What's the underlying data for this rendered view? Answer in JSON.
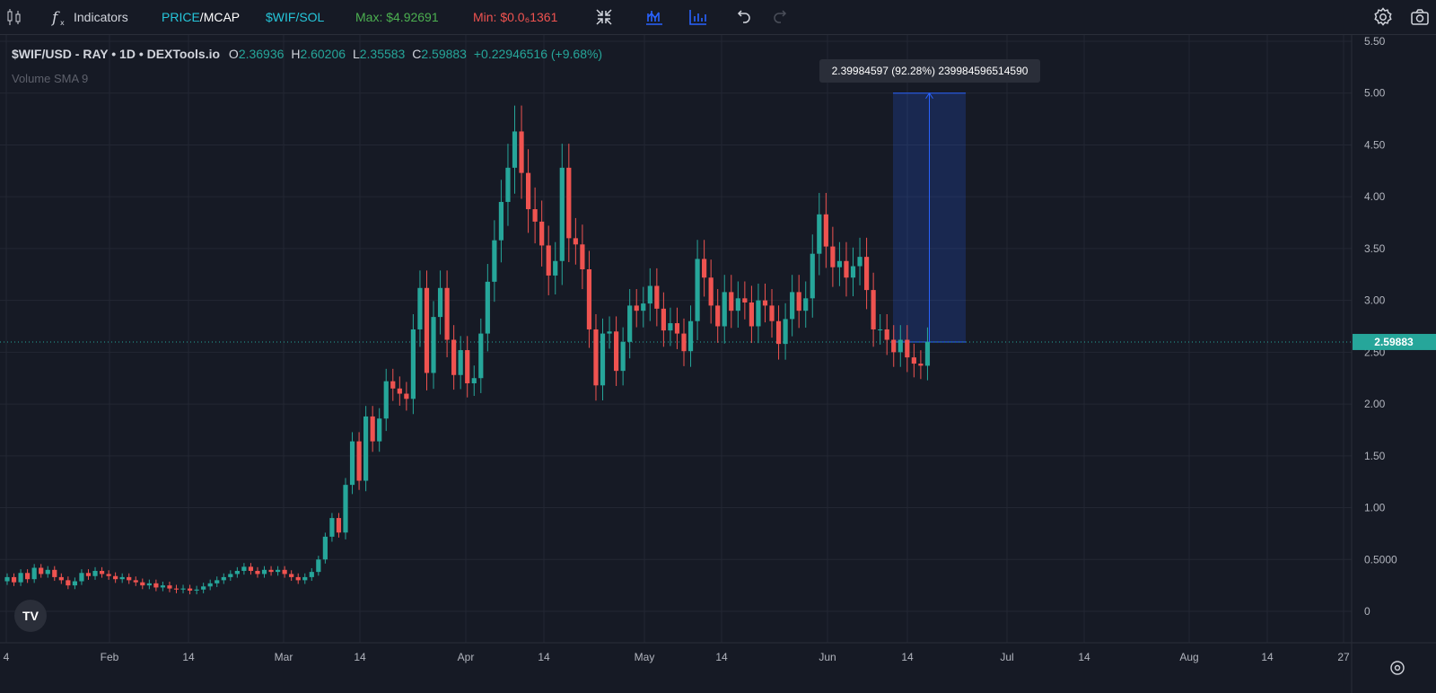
{
  "toolbar": {
    "indicators_label": "Indicators",
    "price_label": "PRICE",
    "slash": "/",
    "mcap_label": "MCAP",
    "pair_label": "$WIF/SOL",
    "max_label": "Max: $4.92691",
    "min_label": "Min: $0.0₆1361",
    "icons": [
      "candles-icon",
      "fx-icon",
      "collapse-icon",
      "chart-type-icon",
      "bars-icon",
      "undo-icon",
      "redo-icon",
      "settings-icon",
      "camera-icon"
    ]
  },
  "legend": {
    "symbol": "$WIF/USD - RAY • 1D • DEXTools.io",
    "o_label": "O",
    "o_value": "2.36936",
    "h_label": "H",
    "h_value": "2.60206",
    "l_label": "L",
    "l_value": "2.35583",
    "c_label": "C",
    "c_value": "2.59883",
    "change": "+0.22946516 (+9.68%)",
    "indicator": "Volume SMA 9"
  },
  "measure_label": "2.39984597 (92.28%) 239984596514590",
  "colors": {
    "up": "#26a69a",
    "down": "#ef5350",
    "bg": "#161a25",
    "grid": "#232733",
    "accent": "#2962ff"
  },
  "chart_data": {
    "type": "candlestick",
    "y_ticks": [
      "5.50",
      "5.00",
      "4.50",
      "4.00",
      "3.50",
      "3.00",
      "2.50",
      "2.00",
      "1.50",
      "1.00",
      "0.5000",
      "0"
    ],
    "ylim": [
      0,
      5.5
    ],
    "x_ticks": [
      "4",
      "Feb",
      "14",
      "Mar",
      "14",
      "Apr",
      "14",
      "May",
      "14",
      "Jun",
      "14",
      "Jul",
      "14",
      "Aug",
      "14",
      "27"
    ],
    "last_price": 2.59883,
    "last_price_label": "2.59883",
    "measure": {
      "from": 2.59883,
      "to": 5.0
    },
    "series": [
      {
        "o": 0.29,
        "c": 0.33
      },
      {
        "o": 0.33,
        "c": 0.28
      },
      {
        "o": 0.28,
        "c": 0.37
      },
      {
        "o": 0.37,
        "c": 0.31
      },
      {
        "o": 0.31,
        "c": 0.42
      },
      {
        "o": 0.42,
        "c": 0.36
      },
      {
        "o": 0.36,
        "c": 0.4
      },
      {
        "o": 0.4,
        "c": 0.33
      },
      {
        "o": 0.33,
        "c": 0.3
      },
      {
        "o": 0.3,
        "c": 0.25
      },
      {
        "o": 0.25,
        "c": 0.29
      },
      {
        "o": 0.29,
        "c": 0.37
      },
      {
        "o": 0.37,
        "c": 0.34
      },
      {
        "o": 0.34,
        "c": 0.39
      },
      {
        "o": 0.39,
        "c": 0.36
      },
      {
        "o": 0.36,
        "c": 0.34
      },
      {
        "o": 0.34,
        "c": 0.31
      },
      {
        "o": 0.31,
        "c": 0.33
      },
      {
        "o": 0.33,
        "c": 0.3
      },
      {
        "o": 0.3,
        "c": 0.28
      },
      {
        "o": 0.28,
        "c": 0.25
      },
      {
        "o": 0.25,
        "c": 0.27
      },
      {
        "o": 0.27,
        "c": 0.23
      },
      {
        "o": 0.23,
        "c": 0.25
      },
      {
        "o": 0.25,
        "c": 0.22
      },
      {
        "o": 0.22,
        "c": 0.21
      },
      {
        "o": 0.21,
        "c": 0.22
      },
      {
        "o": 0.22,
        "c": 0.2
      },
      {
        "o": 0.2,
        "c": 0.21
      },
      {
        "o": 0.21,
        "c": 0.24
      },
      {
        "o": 0.24,
        "c": 0.27
      },
      {
        "o": 0.27,
        "c": 0.3
      },
      {
        "o": 0.3,
        "c": 0.33
      },
      {
        "o": 0.33,
        "c": 0.36
      },
      {
        "o": 0.36,
        "c": 0.39
      },
      {
        "o": 0.39,
        "c": 0.43
      },
      {
        "o": 0.43,
        "c": 0.39
      },
      {
        "o": 0.39,
        "c": 0.36
      },
      {
        "o": 0.36,
        "c": 0.4
      },
      {
        "o": 0.4,
        "c": 0.38
      },
      {
        "o": 0.38,
        "c": 0.4
      },
      {
        "o": 0.4,
        "c": 0.36
      },
      {
        "o": 0.36,
        "c": 0.33
      },
      {
        "o": 0.33,
        "c": 0.3
      },
      {
        "o": 0.3,
        "c": 0.33
      },
      {
        "o": 0.33,
        "c": 0.38
      },
      {
        "o": 0.38,
        "c": 0.5
      },
      {
        "o": 0.5,
        "c": 0.72
      },
      {
        "o": 0.72,
        "c": 0.9
      },
      {
        "o": 0.9,
        "c": 0.76
      },
      {
        "o": 0.76,
        "c": 1.22
      },
      {
        "o": 1.22,
        "c": 1.64
      },
      {
        "o": 1.64,
        "c": 1.26
      },
      {
        "o": 1.26,
        "c": 1.88
      },
      {
        "o": 1.88,
        "c": 1.64
      },
      {
        "o": 1.64,
        "c": 1.86
      },
      {
        "o": 1.86,
        "c": 2.22
      },
      {
        "o": 2.22,
        "c": 2.15
      },
      {
        "o": 2.15,
        "c": 2.1
      },
      {
        "o": 2.1,
        "c": 2.05
      },
      {
        "o": 2.05,
        "c": 2.72
      },
      {
        "o": 2.72,
        "c": 3.12
      },
      {
        "o": 3.12,
        "c": 2.3
      },
      {
        "o": 2.3,
        "c": 2.84
      },
      {
        "o": 2.84,
        "c": 3.12
      },
      {
        "o": 3.12,
        "c": 2.62
      },
      {
        "o": 2.62,
        "c": 2.28
      },
      {
        "o": 2.28,
        "c": 2.52
      },
      {
        "o": 2.52,
        "c": 2.2
      },
      {
        "o": 2.2,
        "c": 2.25
      },
      {
        "o": 2.25,
        "c": 2.68
      },
      {
        "o": 2.68,
        "c": 3.18
      },
      {
        "o": 3.18,
        "c": 3.58
      },
      {
        "o": 3.58,
        "c": 3.95
      },
      {
        "o": 3.95,
        "c": 4.28
      },
      {
        "o": 4.28,
        "c": 4.63
      },
      {
        "o": 4.63,
        "c": 4.23
      },
      {
        "o": 4.23,
        "c": 3.88
      },
      {
        "o": 3.88,
        "c": 3.76
      },
      {
        "o": 3.76,
        "c": 3.53
      },
      {
        "o": 3.53,
        "c": 3.24
      },
      {
        "o": 3.24,
        "c": 3.38
      },
      {
        "o": 3.38,
        "c": 4.28
      },
      {
        "o": 4.28,
        "c": 3.6
      },
      {
        "o": 3.6,
        "c": 3.54
      },
      {
        "o": 3.54,
        "c": 3.3
      },
      {
        "o": 3.3,
        "c": 2.72
      },
      {
        "o": 2.72,
        "c": 2.18
      },
      {
        "o": 2.18,
        "c": 2.68
      },
      {
        "o": 2.68,
        "c": 2.7
      },
      {
        "o": 2.7,
        "c": 2.32
      },
      {
        "o": 2.32,
        "c": 2.6
      },
      {
        "o": 2.6,
        "c": 2.95
      },
      {
        "o": 2.95,
        "c": 2.9
      },
      {
        "o": 2.9,
        "c": 2.97
      },
      {
        "o": 2.97,
        "c": 3.14
      },
      {
        "o": 3.14,
        "c": 2.92
      },
      {
        "o": 2.92,
        "c": 2.71
      },
      {
        "o": 2.71,
        "c": 2.78
      },
      {
        "o": 2.78,
        "c": 2.68
      },
      {
        "o": 2.68,
        "c": 2.51
      },
      {
        "o": 2.51,
        "c": 2.8
      },
      {
        "o": 2.8,
        "c": 3.4
      },
      {
        "o": 3.4,
        "c": 3.22
      },
      {
        "o": 3.22,
        "c": 2.95
      },
      {
        "o": 2.95,
        "c": 2.75
      },
      {
        "o": 2.75,
        "c": 3.08
      },
      {
        "o": 3.08,
        "c": 2.9
      },
      {
        "o": 2.9,
        "c": 3.02
      },
      {
        "o": 3.02,
        "c": 2.98
      },
      {
        "o": 2.98,
        "c": 2.75
      },
      {
        "o": 2.75,
        "c": 3.0
      },
      {
        "o": 3.0,
        "c": 2.95
      },
      {
        "o": 2.95,
        "c": 2.8
      },
      {
        "o": 2.8,
        "c": 2.58
      },
      {
        "o": 2.58,
        "c": 2.82
      },
      {
        "o": 2.82,
        "c": 3.08
      },
      {
        "o": 3.08,
        "c": 2.9
      },
      {
        "o": 2.9,
        "c": 3.02
      },
      {
        "o": 3.02,
        "c": 3.45
      },
      {
        "o": 3.45,
        "c": 3.83
      },
      {
        "o": 3.83,
        "c": 3.52
      },
      {
        "o": 3.52,
        "c": 3.32
      },
      {
        "o": 3.32,
        "c": 3.38
      },
      {
        "o": 3.38,
        "c": 3.22
      },
      {
        "o": 3.22,
        "c": 3.33
      },
      {
        "o": 3.33,
        "c": 3.42
      },
      {
        "o": 3.42,
        "c": 3.1
      },
      {
        "o": 3.1,
        "c": 2.72
      },
      {
        "o": 2.72,
        "c": 2.72
      },
      {
        "o": 2.72,
        "c": 2.62
      },
      {
        "o": 2.62,
        "c": 2.5
      },
      {
        "o": 2.5,
        "c": 2.62
      },
      {
        "o": 2.62,
        "c": 2.45
      },
      {
        "o": 2.45,
        "c": 2.39
      },
      {
        "o": 2.39,
        "c": 2.37
      },
      {
        "o": 2.36936,
        "c": 2.59883
      }
    ]
  }
}
